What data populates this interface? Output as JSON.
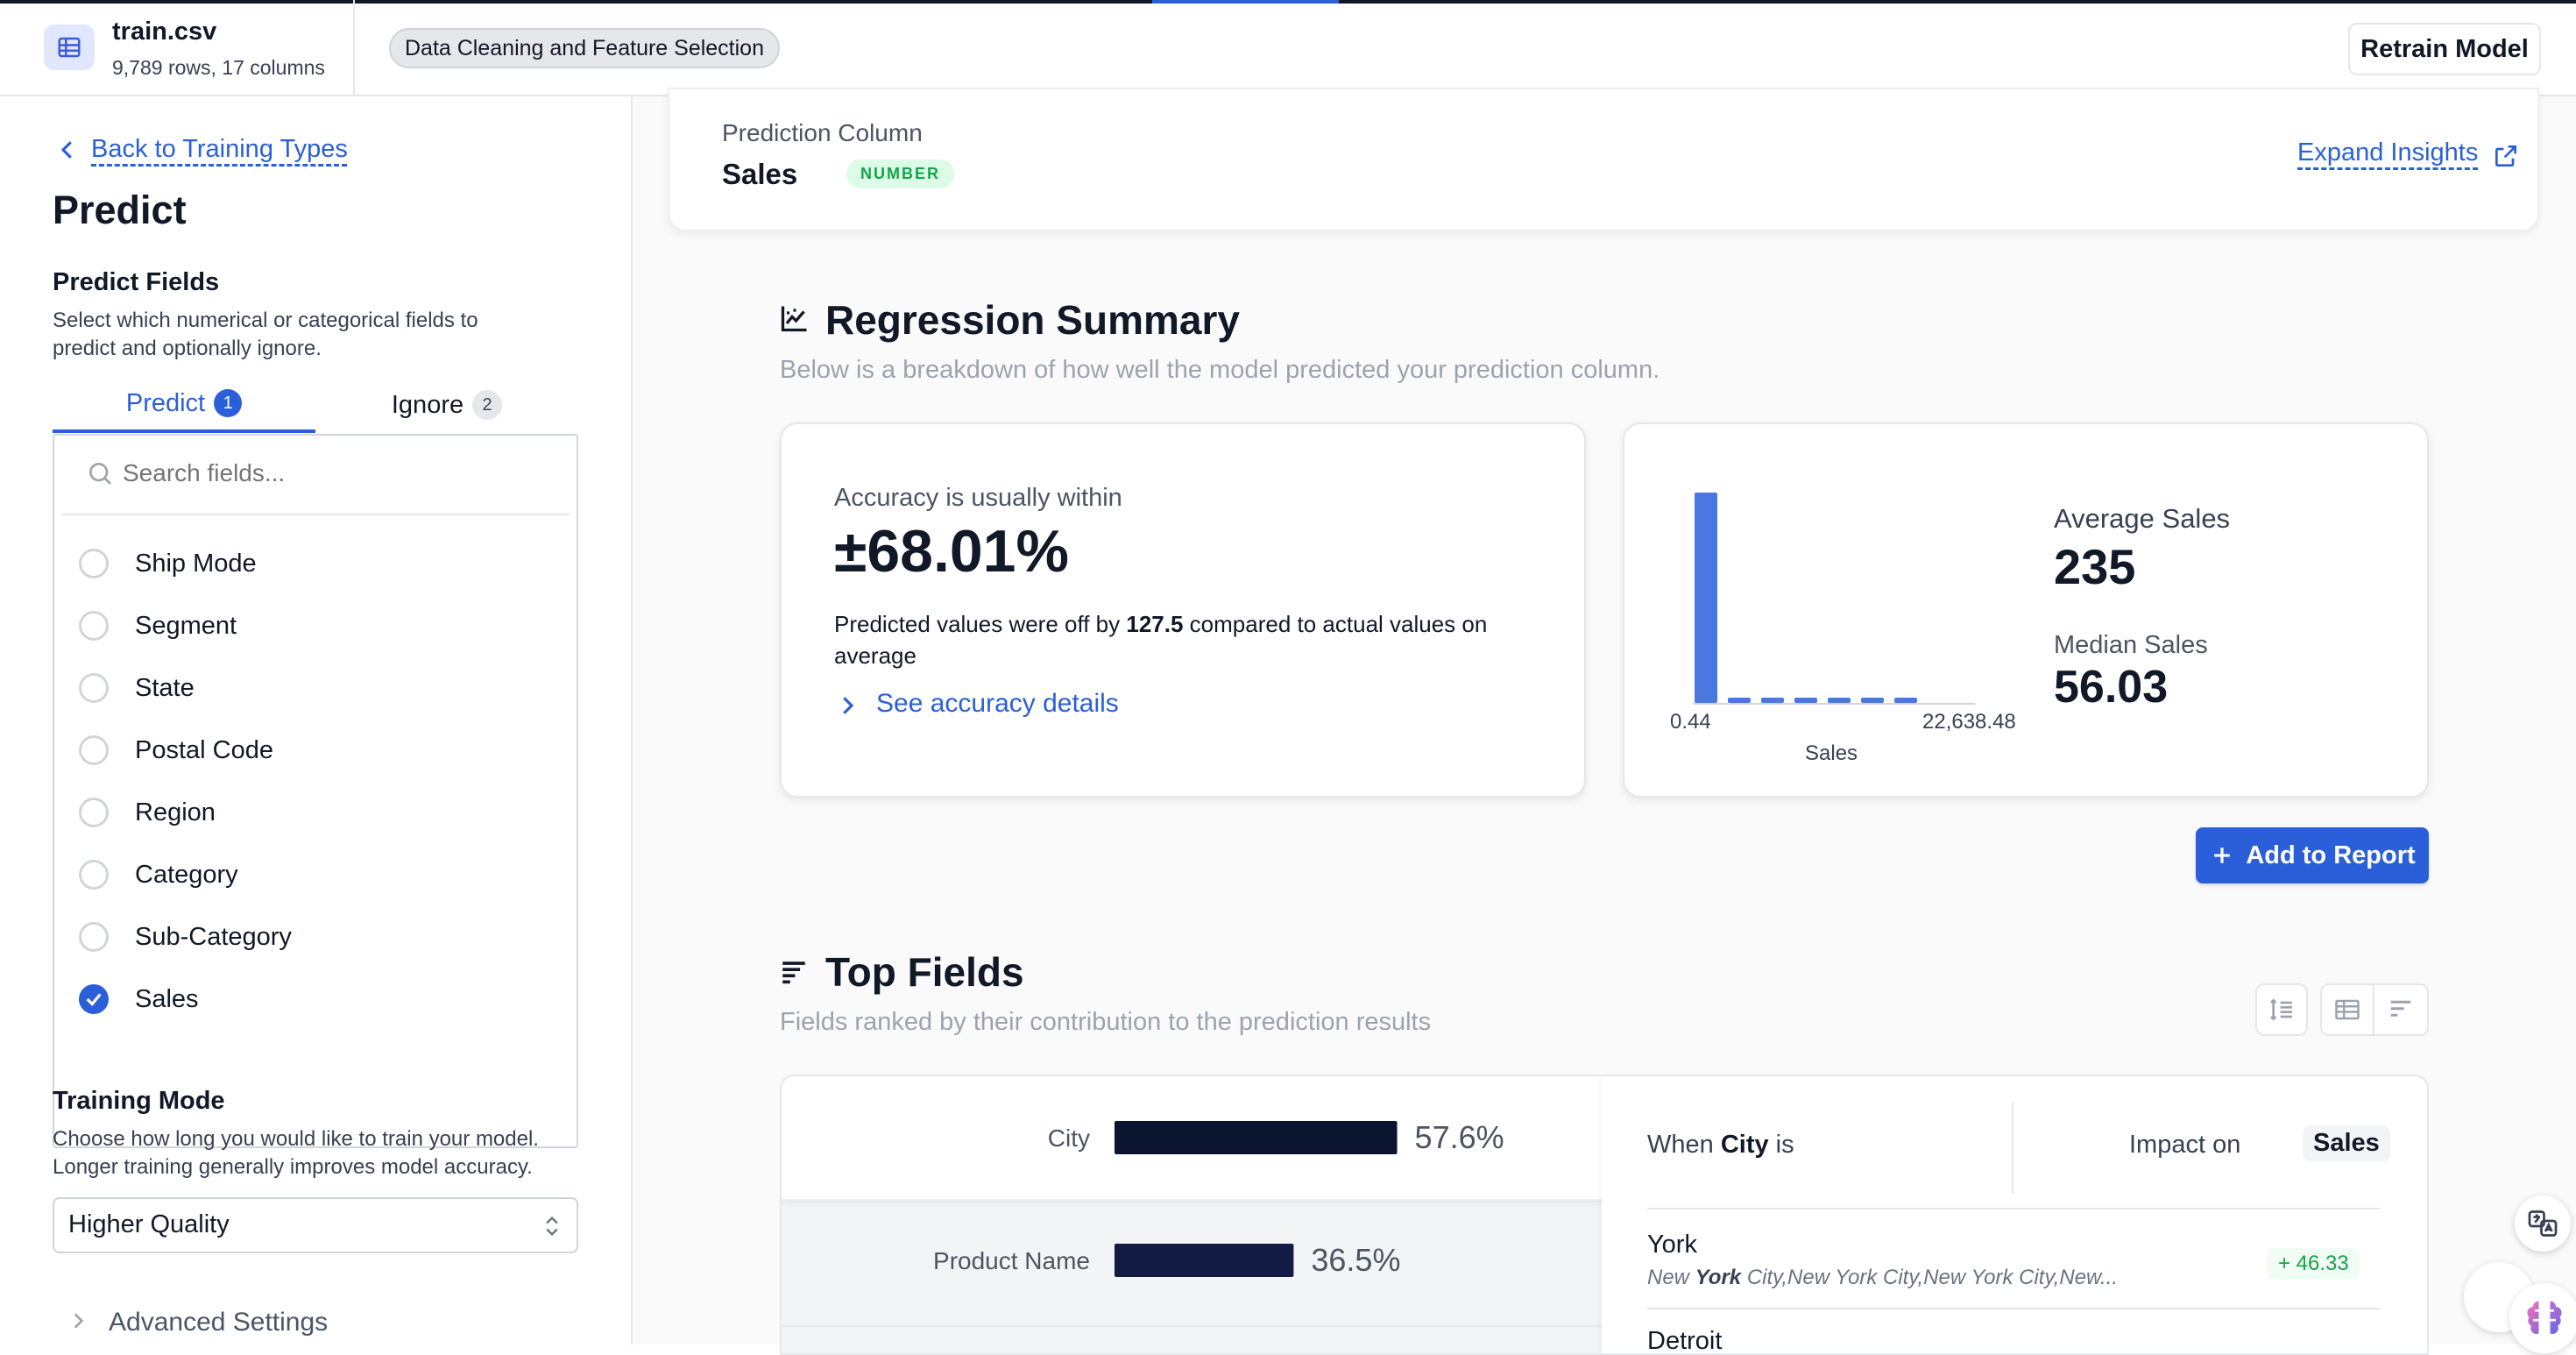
{
  "header": {
    "file_name": "train.csv",
    "file_meta": "9,789 rows, 17 columns",
    "step_badge": "Data Cleaning and Feature Selection",
    "retrain_label": "Retrain Model"
  },
  "sidebar": {
    "back_label": "Back to Training Types",
    "title": "Predict",
    "predict_fields_heading": "Predict Fields",
    "predict_fields_desc": "Select which numerical or categorical fields to predict and optionally ignore.",
    "tabs": [
      {
        "label": "Predict",
        "count": "1"
      },
      {
        "label": "Ignore",
        "count": "2"
      }
    ],
    "search_placeholder": "Search fields...",
    "fields": [
      {
        "label": "Ship Mode",
        "checked": false
      },
      {
        "label": "Segment",
        "checked": false
      },
      {
        "label": "State",
        "checked": false
      },
      {
        "label": "Postal Code",
        "checked": false
      },
      {
        "label": "Region",
        "checked": false
      },
      {
        "label": "Category",
        "checked": false
      },
      {
        "label": "Sub-Category",
        "checked": false
      },
      {
        "label": "Sales",
        "checked": true
      }
    ],
    "training_mode_heading": "Training Mode",
    "training_mode_desc": "Choose how long you would like to train your model. Longer training generally improves model accuracy.",
    "training_mode_value": "Higher Quality",
    "advanced_label": "Advanced Settings"
  },
  "prediction": {
    "label": "Prediction Column",
    "column": "Sales",
    "type_tag": "NUMBER",
    "expand_label": "Expand Insights"
  },
  "regression": {
    "title": "Regression Summary",
    "subtitle": "Below is a breakdown of how well the model predicted your prediction column.",
    "accuracy_label": "Accuracy is usually within",
    "accuracy_value": "±68.01%",
    "off_text_pre": "Predicted values were off by ",
    "off_value": "127.5",
    "off_text_post": " compared to actual values on average",
    "see_details": "See accuracy details",
    "avg_label": "Average Sales",
    "avg_value": "235",
    "median_label": "Median Sales",
    "median_value": "56.03",
    "add_report": "Add to Report"
  },
  "histogram": {
    "chart_data": {
      "type": "bar",
      "xlabel": "Sales",
      "x_min_label": "0.44",
      "x_max_label": "22,638.48",
      "values": [
        100,
        2.5,
        2.5,
        2.5,
        2.5,
        2.5,
        2.5
      ]
    }
  },
  "top_fields": {
    "title": "Top Fields",
    "subtitle": "Fields ranked by their contribution to the prediction results",
    "chart_data": {
      "type": "bar",
      "categories": [
        "City",
        "Product Name"
      ],
      "values": [
        57.6,
        36.5
      ],
      "value_labels": [
        "57.6%",
        "36.5%"
      ]
    },
    "when_prefix": "When ",
    "when_field": "City",
    "when_suffix": " is",
    "impact_label": "Impact on",
    "impact_field": "Sales",
    "rows": [
      {
        "name": "York",
        "detail_bold": "York",
        "detail_pre": "New ",
        "detail_post": " City,New York City,New York City,New...",
        "impact": "+ 46.33"
      },
      {
        "name": "Detroit"
      }
    ]
  },
  "colors": {
    "accent": "#2b5fd9",
    "bar_dark": "#0b1530",
    "hist_bar": "#4a77e0",
    "impact_green": "#16a34a"
  },
  "icons": [
    "table-icon",
    "chevron-left-icon",
    "search-icon",
    "check-icon",
    "chevron-updown-icon",
    "chevron-right-icon",
    "external-link-icon",
    "chart-line-icon",
    "plus-icon",
    "bars-icon",
    "sort-icon",
    "table-view-icon",
    "bar-view-icon",
    "translate-icon",
    "brain-icon"
  ]
}
